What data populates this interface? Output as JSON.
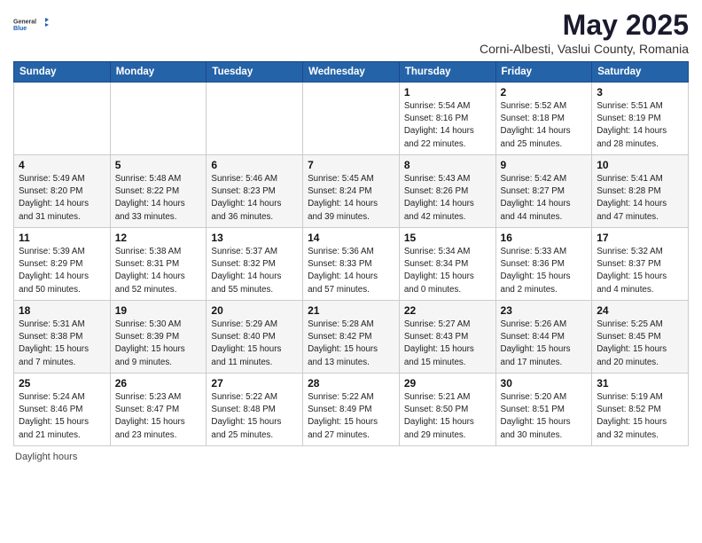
{
  "header": {
    "logo_general": "General",
    "logo_blue": "Blue",
    "title": "May 2025",
    "location": "Corni-Albesti, Vaslui County, Romania"
  },
  "days_of_week": [
    "Sunday",
    "Monday",
    "Tuesday",
    "Wednesday",
    "Thursday",
    "Friday",
    "Saturday"
  ],
  "weeks": [
    [
      {
        "day": "",
        "info": ""
      },
      {
        "day": "",
        "info": ""
      },
      {
        "day": "",
        "info": ""
      },
      {
        "day": "",
        "info": ""
      },
      {
        "day": "1",
        "info": "Sunrise: 5:54 AM\nSunset: 8:16 PM\nDaylight: 14 hours\nand 22 minutes."
      },
      {
        "day": "2",
        "info": "Sunrise: 5:52 AM\nSunset: 8:18 PM\nDaylight: 14 hours\nand 25 minutes."
      },
      {
        "day": "3",
        "info": "Sunrise: 5:51 AM\nSunset: 8:19 PM\nDaylight: 14 hours\nand 28 minutes."
      }
    ],
    [
      {
        "day": "4",
        "info": "Sunrise: 5:49 AM\nSunset: 8:20 PM\nDaylight: 14 hours\nand 31 minutes."
      },
      {
        "day": "5",
        "info": "Sunrise: 5:48 AM\nSunset: 8:22 PM\nDaylight: 14 hours\nand 33 minutes."
      },
      {
        "day": "6",
        "info": "Sunrise: 5:46 AM\nSunset: 8:23 PM\nDaylight: 14 hours\nand 36 minutes."
      },
      {
        "day": "7",
        "info": "Sunrise: 5:45 AM\nSunset: 8:24 PM\nDaylight: 14 hours\nand 39 minutes."
      },
      {
        "day": "8",
        "info": "Sunrise: 5:43 AM\nSunset: 8:26 PM\nDaylight: 14 hours\nand 42 minutes."
      },
      {
        "day": "9",
        "info": "Sunrise: 5:42 AM\nSunset: 8:27 PM\nDaylight: 14 hours\nand 44 minutes."
      },
      {
        "day": "10",
        "info": "Sunrise: 5:41 AM\nSunset: 8:28 PM\nDaylight: 14 hours\nand 47 minutes."
      }
    ],
    [
      {
        "day": "11",
        "info": "Sunrise: 5:39 AM\nSunset: 8:29 PM\nDaylight: 14 hours\nand 50 minutes."
      },
      {
        "day": "12",
        "info": "Sunrise: 5:38 AM\nSunset: 8:31 PM\nDaylight: 14 hours\nand 52 minutes."
      },
      {
        "day": "13",
        "info": "Sunrise: 5:37 AM\nSunset: 8:32 PM\nDaylight: 14 hours\nand 55 minutes."
      },
      {
        "day": "14",
        "info": "Sunrise: 5:36 AM\nSunset: 8:33 PM\nDaylight: 14 hours\nand 57 minutes."
      },
      {
        "day": "15",
        "info": "Sunrise: 5:34 AM\nSunset: 8:34 PM\nDaylight: 15 hours\nand 0 minutes."
      },
      {
        "day": "16",
        "info": "Sunrise: 5:33 AM\nSunset: 8:36 PM\nDaylight: 15 hours\nand 2 minutes."
      },
      {
        "day": "17",
        "info": "Sunrise: 5:32 AM\nSunset: 8:37 PM\nDaylight: 15 hours\nand 4 minutes."
      }
    ],
    [
      {
        "day": "18",
        "info": "Sunrise: 5:31 AM\nSunset: 8:38 PM\nDaylight: 15 hours\nand 7 minutes."
      },
      {
        "day": "19",
        "info": "Sunrise: 5:30 AM\nSunset: 8:39 PM\nDaylight: 15 hours\nand 9 minutes."
      },
      {
        "day": "20",
        "info": "Sunrise: 5:29 AM\nSunset: 8:40 PM\nDaylight: 15 hours\nand 11 minutes."
      },
      {
        "day": "21",
        "info": "Sunrise: 5:28 AM\nSunset: 8:42 PM\nDaylight: 15 hours\nand 13 minutes."
      },
      {
        "day": "22",
        "info": "Sunrise: 5:27 AM\nSunset: 8:43 PM\nDaylight: 15 hours\nand 15 minutes."
      },
      {
        "day": "23",
        "info": "Sunrise: 5:26 AM\nSunset: 8:44 PM\nDaylight: 15 hours\nand 17 minutes."
      },
      {
        "day": "24",
        "info": "Sunrise: 5:25 AM\nSunset: 8:45 PM\nDaylight: 15 hours\nand 20 minutes."
      }
    ],
    [
      {
        "day": "25",
        "info": "Sunrise: 5:24 AM\nSunset: 8:46 PM\nDaylight: 15 hours\nand 21 minutes."
      },
      {
        "day": "26",
        "info": "Sunrise: 5:23 AM\nSunset: 8:47 PM\nDaylight: 15 hours\nand 23 minutes."
      },
      {
        "day": "27",
        "info": "Sunrise: 5:22 AM\nSunset: 8:48 PM\nDaylight: 15 hours\nand 25 minutes."
      },
      {
        "day": "28",
        "info": "Sunrise: 5:22 AM\nSunset: 8:49 PM\nDaylight: 15 hours\nand 27 minutes."
      },
      {
        "day": "29",
        "info": "Sunrise: 5:21 AM\nSunset: 8:50 PM\nDaylight: 15 hours\nand 29 minutes."
      },
      {
        "day": "30",
        "info": "Sunrise: 5:20 AM\nSunset: 8:51 PM\nDaylight: 15 hours\nand 30 minutes."
      },
      {
        "day": "31",
        "info": "Sunrise: 5:19 AM\nSunset: 8:52 PM\nDaylight: 15 hours\nand 32 minutes."
      }
    ]
  ],
  "footer": {
    "text": "Daylight hours"
  }
}
